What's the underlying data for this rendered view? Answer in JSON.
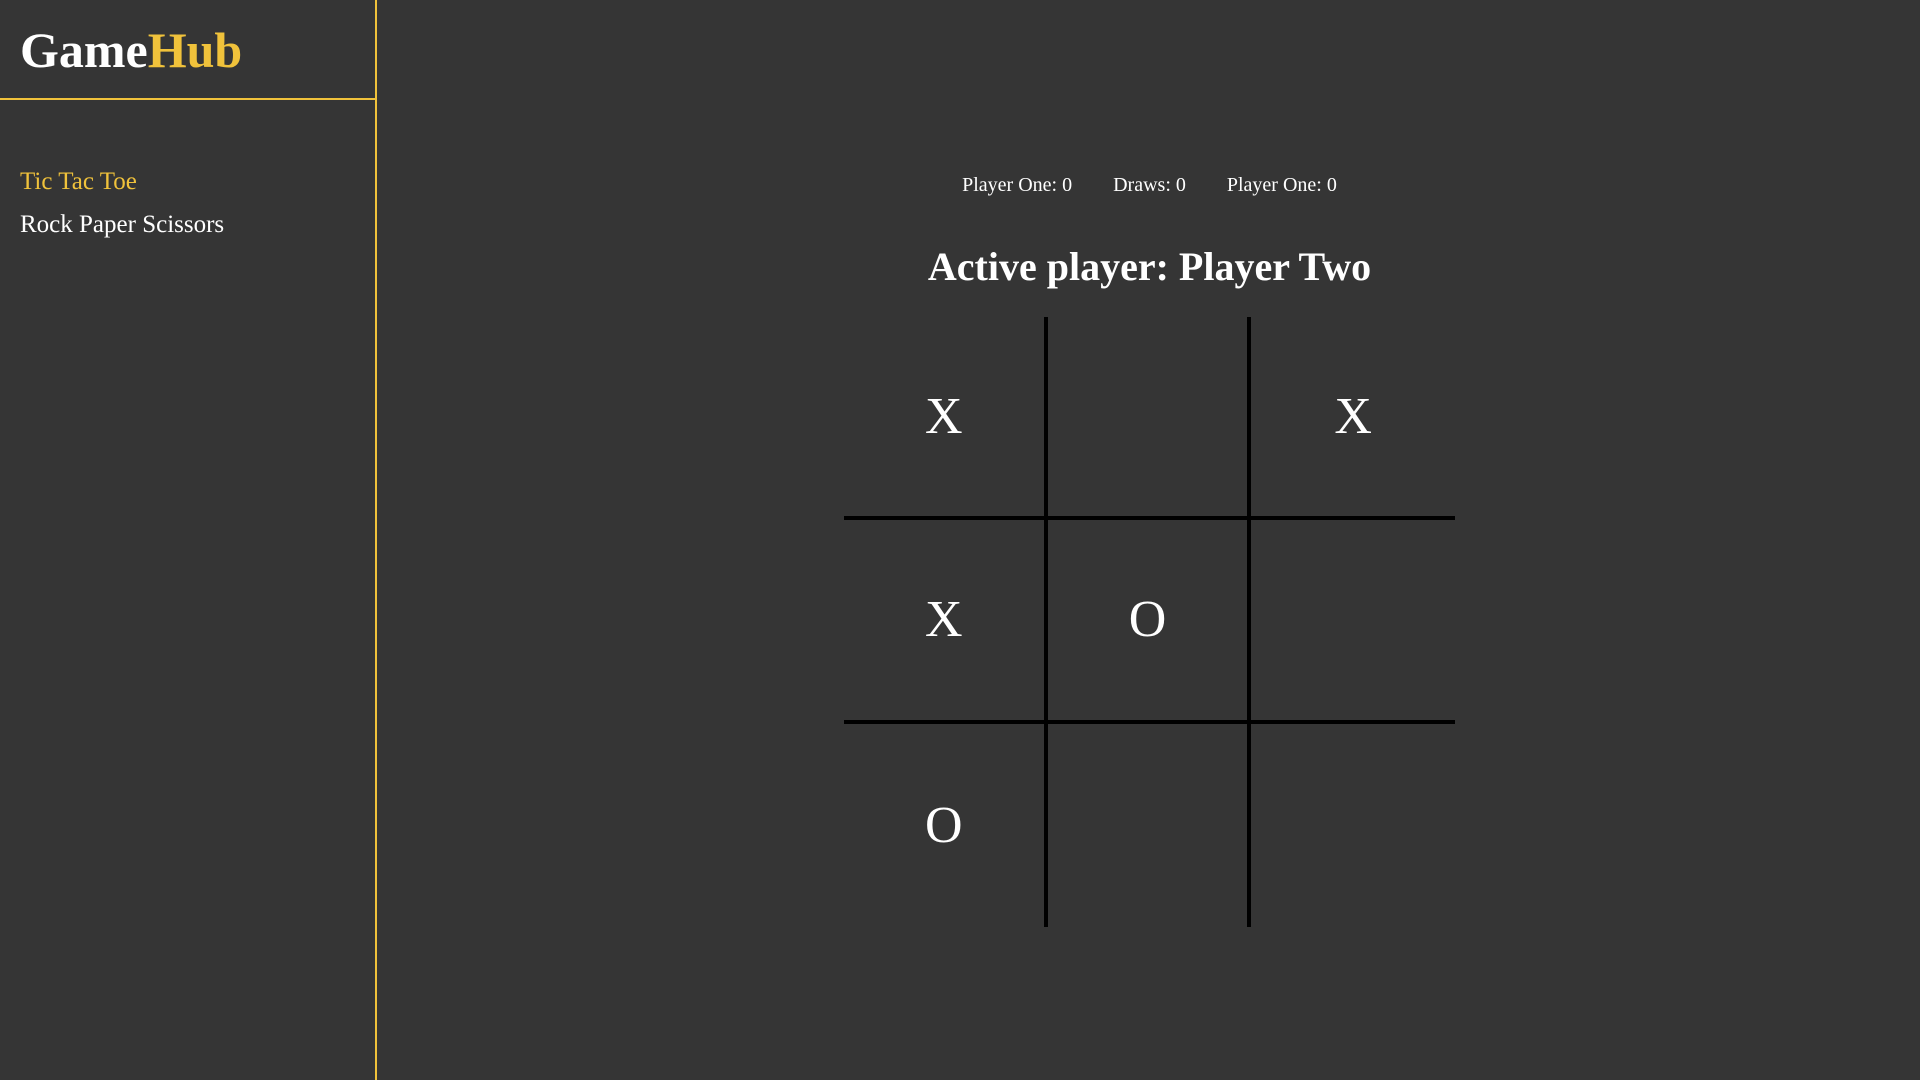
{
  "logo": {
    "part1": "Game",
    "part2": "Hub"
  },
  "nav": {
    "items": [
      {
        "label": "Tic Tac Toe",
        "active": true
      },
      {
        "label": "Rock Paper Scissors",
        "active": false
      }
    ]
  },
  "scoreboard": {
    "player_one": "Player One: 0",
    "draws": "Draws: 0",
    "player_two": "Player One: 0"
  },
  "status": {
    "active_player": "Active player: Player Two"
  },
  "board": {
    "cells": [
      "X",
      "",
      "X",
      "X",
      "O",
      "",
      "O",
      "",
      ""
    ]
  },
  "colors": {
    "accent": "#f0c23b",
    "background": "#353535",
    "text": "#ffffff",
    "grid_lines": "#000000"
  }
}
